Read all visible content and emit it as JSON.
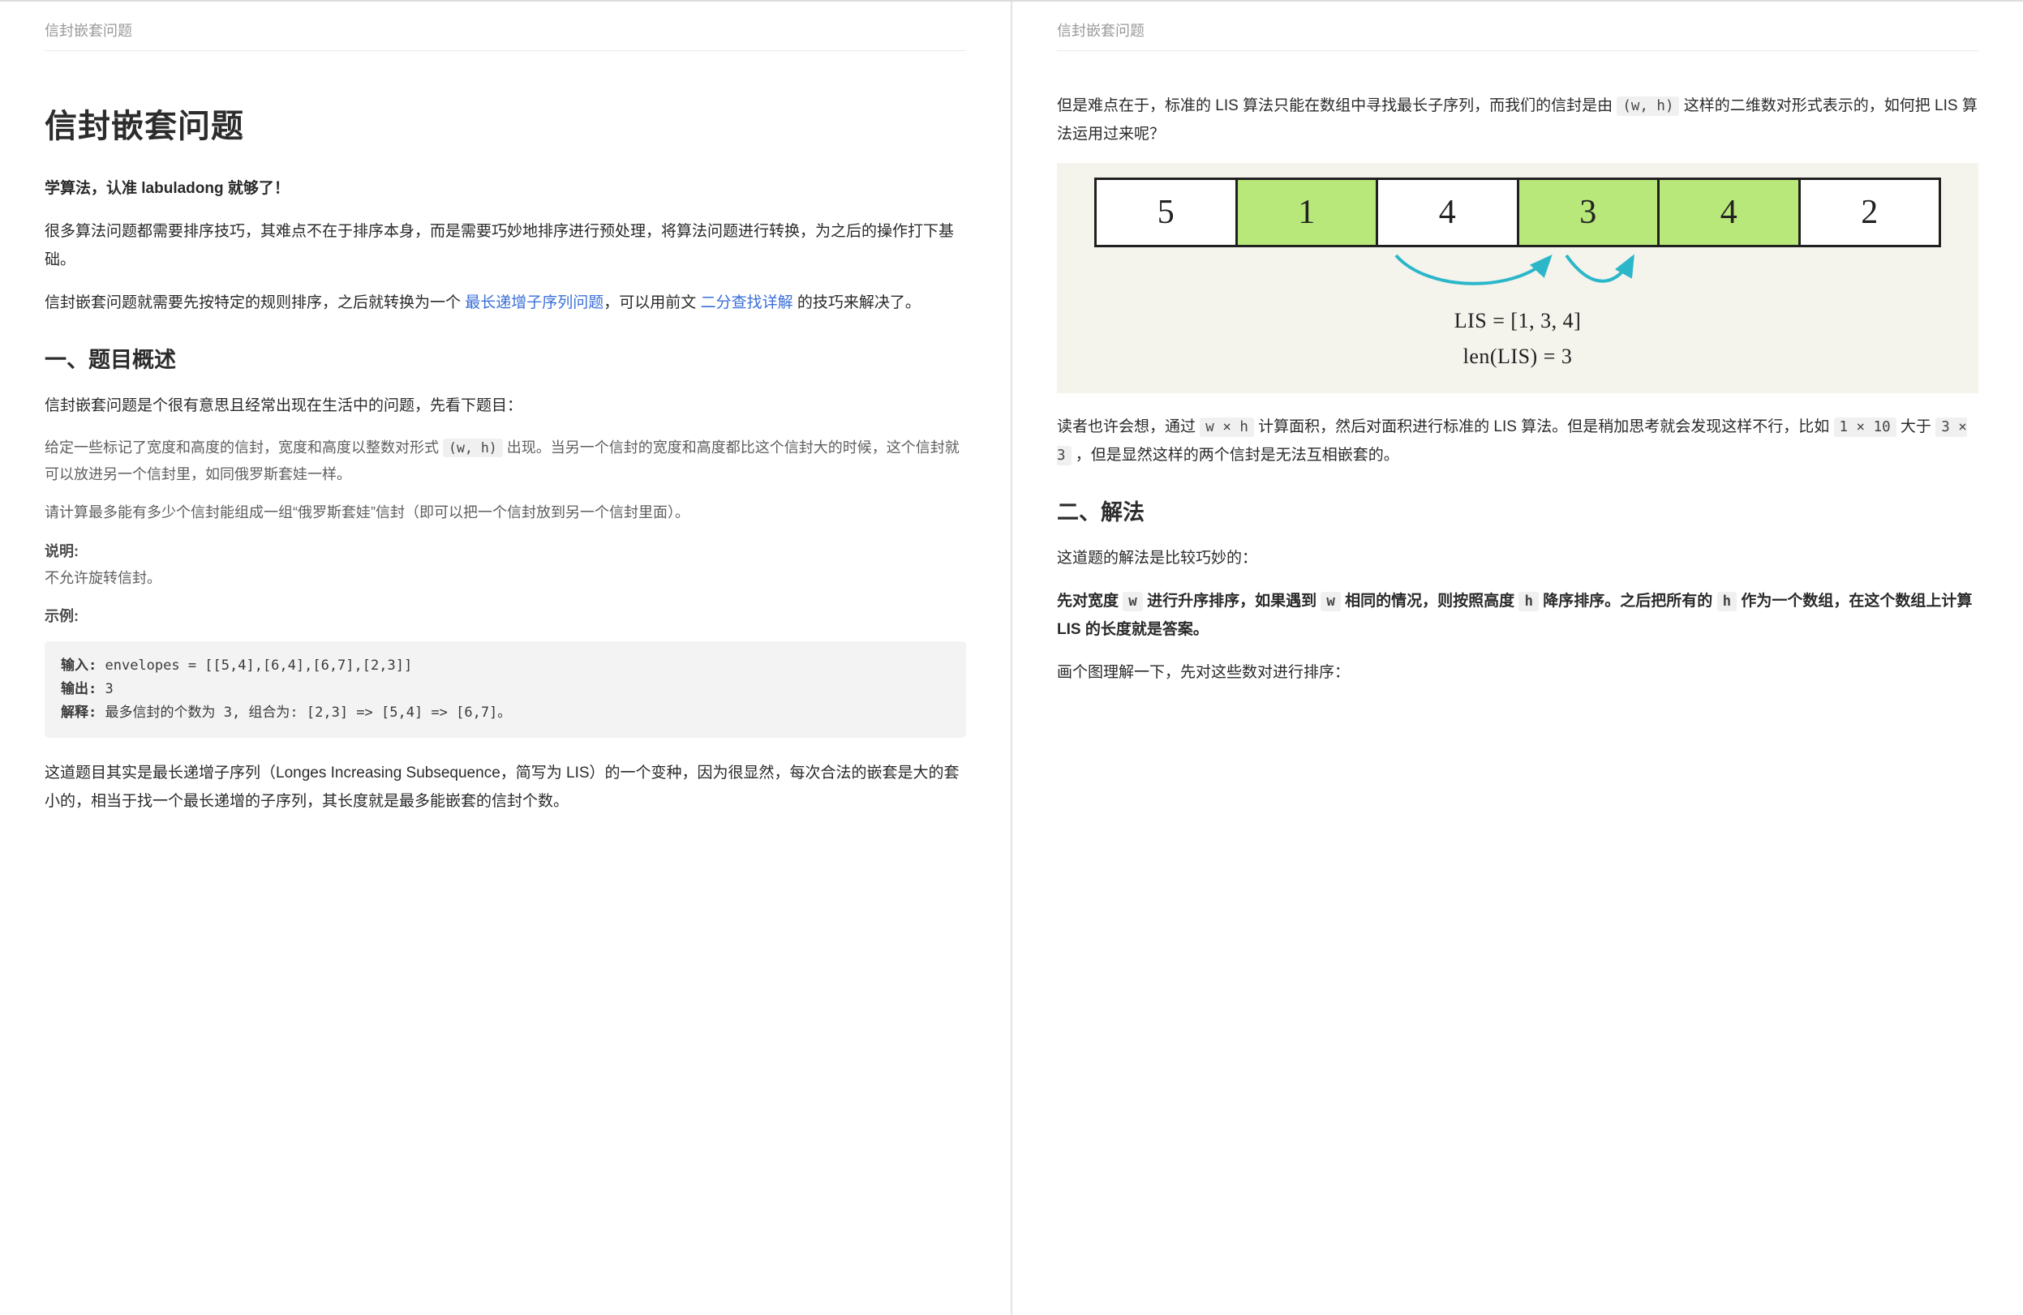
{
  "header": {
    "running_title": "信封嵌套问题"
  },
  "left": {
    "title": "信封嵌套问题",
    "lead": "学算法，认准 labuladong 就够了！",
    "p1": "很多算法问题都需要排序技巧，其难点不在于排序本身，而是需要巧妙地排序进行预处理，将算法问题进行转换，为之后的操作打下基础。",
    "p2a": "信封嵌套问题就需要先按特定的规则排序，之后就转换为一个 ",
    "link1": "最长递增子序列问题",
    "p2b": "，可以用前文 ",
    "link2": "二分查找详解",
    "p2c": " 的技巧来解决了。",
    "h2_1": "一、题目概述",
    "p3": "信封嵌套问题是个很有意思且经常出现在生活中的问题，先看下题目：",
    "quote": {
      "q1a": "给定一些标记了宽度和高度的信封，宽度和高度以整数对形式 ",
      "q1_code": "(w, h)",
      "q1b": " 出现。当另一个信封的宽度和高度都比这个信封大的时候，这个信封就可以放进另一个信封里，如同俄罗斯套娃一样。",
      "q2": "请计算最多能有多少个信封能组成一组“俄罗斯套娃”信封（即可以把一个信封放到另一个信封里面）。",
      "note_lbl": "说明:",
      "note_txt": "不允许旋转信封。",
      "ex_lbl": "示例:"
    },
    "code": {
      "in_lbl": "输入:",
      "in_val": " envelopes = [[5,4],[6,4],[6,7],[2,3]]",
      "out_lbl": "输出:",
      "out_val": " 3",
      "exp_lbl": "解释:",
      "exp_val": " 最多信封的个数为 3, 组合为: [2,3] => [5,4] => [6,7]。"
    },
    "p4": "这道题目其实是最长递增子序列（Longes Increasing Subsequence，简写为 LIS）的一个变种，因为很显然，每次合法的嵌套是大的套小的，相当于找一个最长递增的子序列，其长度就是最多能嵌套的信封个数。"
  },
  "right": {
    "p1a": "但是难点在于，标准的 LIS 算法只能在数组中寻找最长子序列，而我们的信封是由 ",
    "p1_code": "(w, h)",
    "p1b": " 这样的二维数对形式表示的，如何把 LIS 算法运用过来呢？",
    "fig": {
      "cells": [
        {
          "v": "5",
          "hi": false
        },
        {
          "v": "1",
          "hi": true
        },
        {
          "v": "4",
          "hi": false
        },
        {
          "v": "3",
          "hi": true
        },
        {
          "v": "4",
          "hi": true
        },
        {
          "v": "2",
          "hi": false
        }
      ],
      "formula1": "LIS = [1, 3, 4]",
      "formula2": "len(LIS) = 3"
    },
    "p2a": "读者也许会想，通过 ",
    "p2_code1": "w × h",
    "p2b": " 计算面积，然后对面积进行标准的 LIS 算法。但是稍加思考就会发现这样不行，比如 ",
    "p2_code2": "1 × 10",
    "p2c": " 大于 ",
    "p2_code3": "3 × 3",
    "p2d": " ，但是显然这样的两个信封是无法互相嵌套的。",
    "h2_2": "二、解法",
    "p3": "这道题的解法是比较巧妙的：",
    "p4a": "先对宽度 ",
    "p4_code1": "w",
    "p4b": " 进行升序排序，如果遇到 ",
    "p4_code2": "w",
    "p4c": " 相同的情况，则按照高度 ",
    "p4_code3": "h",
    "p4d": " 降序排序。之后把所有的 ",
    "p4_code4": "h",
    "p4e": " 作为一个数组，在这个数组上计算 LIS 的长度就是答案。",
    "p5": "画个图理解一下，先对这些数对进行排序："
  }
}
